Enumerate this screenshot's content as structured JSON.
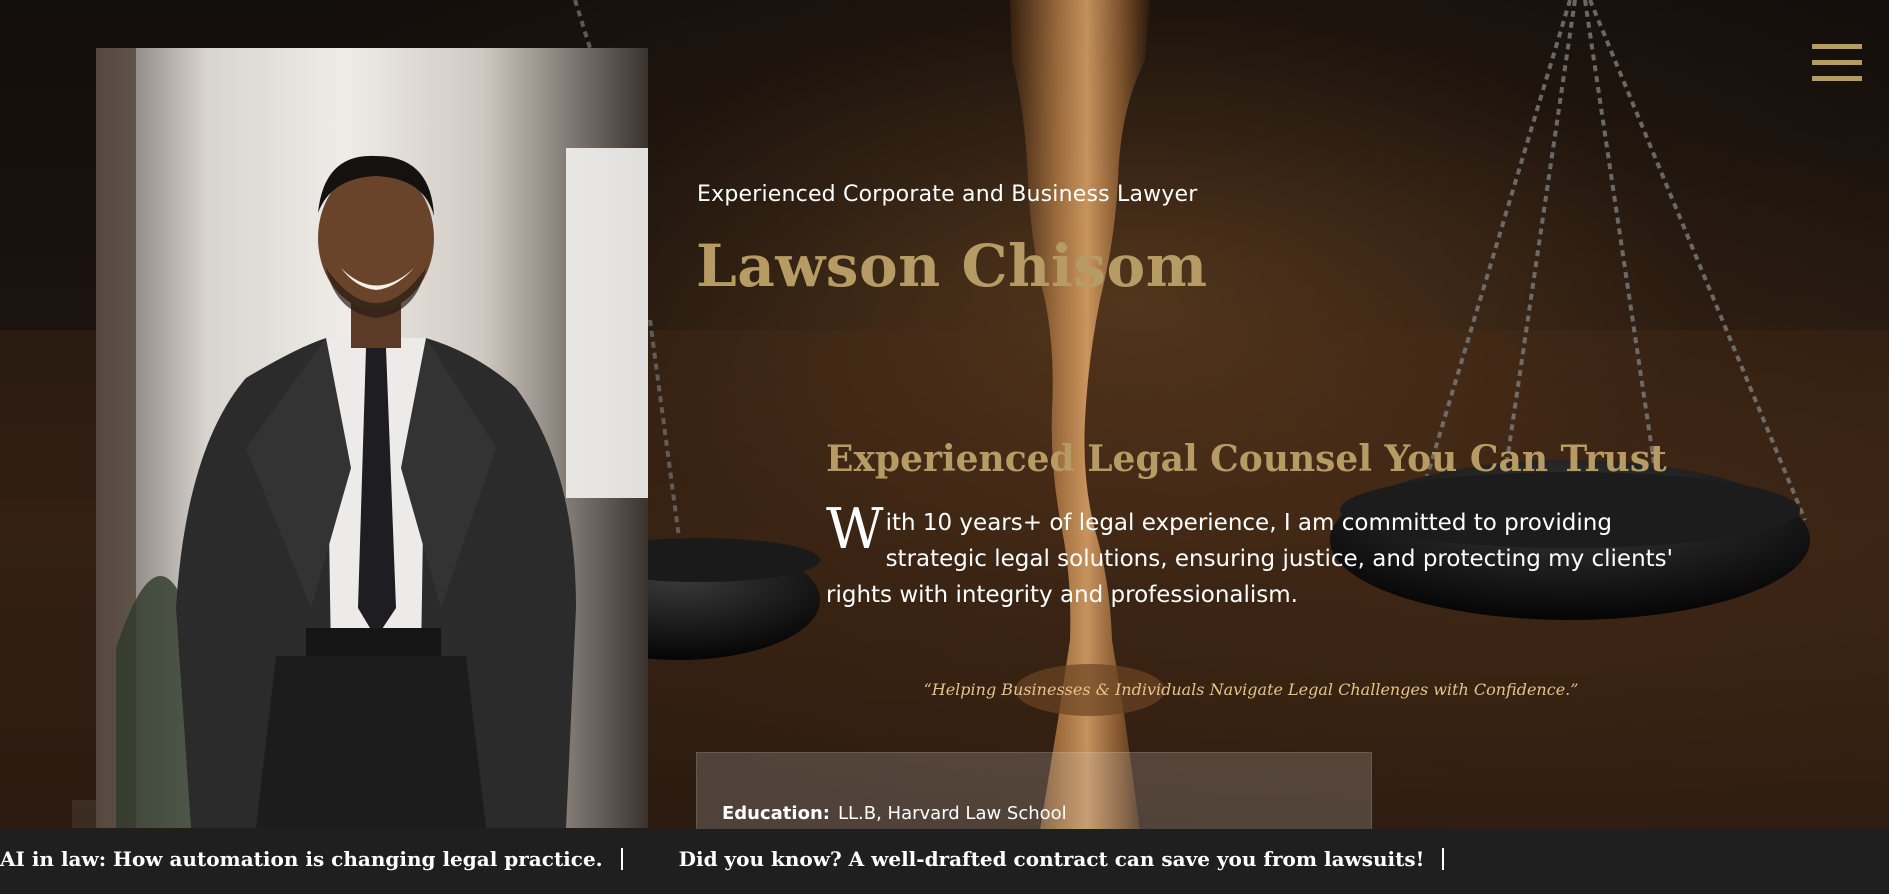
{
  "hero": {
    "eyebrow": "Experienced Corporate and Business Lawyer",
    "name": "Lawson Chisom",
    "headline": "Experienced Legal Counsel You Can Trust",
    "intro_dropcap": "W",
    "intro_rest": "ith 10 years+ of legal experience, I am committed to providing strategic legal solutions, ensuring justice, and protecting my clients' rights with integrity and professionalism.",
    "quote": "“Helping Businesses & Individuals Navigate Legal Challenges with Confidence.”"
  },
  "info_card": {
    "education_label": "Education:",
    "education_value": "LL.B, Harvard Law School"
  },
  "ticker": {
    "items": [
      "AI in law: How automation is changing legal practice.",
      "Did you know? A well-drafted contract can save you from lawsuits!"
    ]
  },
  "icons": {
    "menu": "hamburger-menu-icon",
    "background": "scales-of-justice"
  },
  "colors": {
    "accent": "#b69c64",
    "quote": "#e3c48a",
    "ticker_bg": "#1f1f1f"
  }
}
